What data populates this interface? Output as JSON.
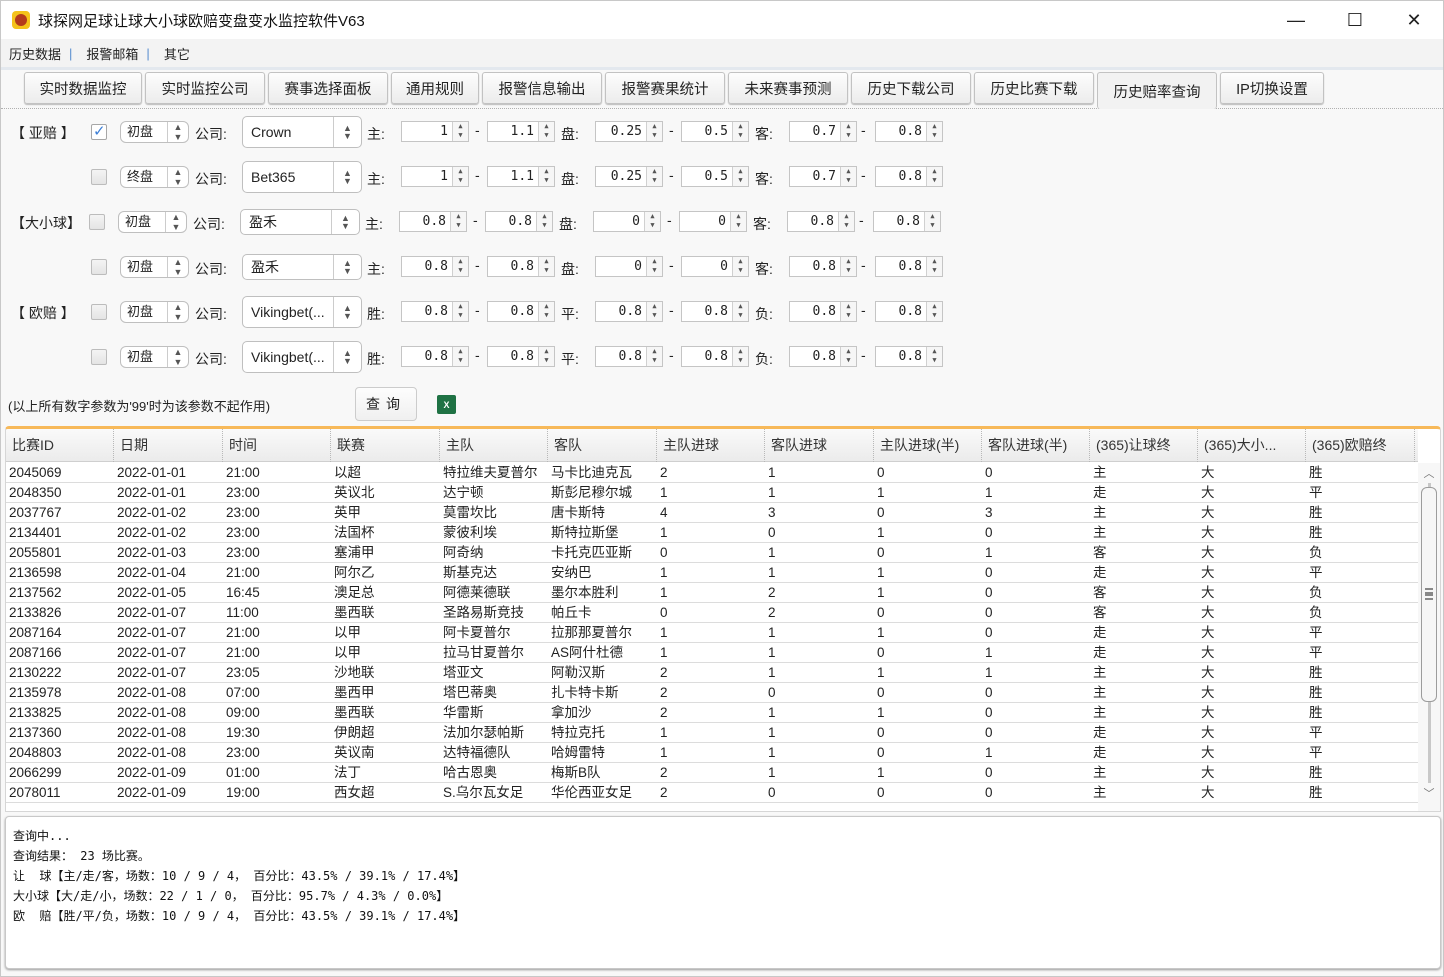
{
  "window": {
    "title": "球探网足球让球大小球欧赔变盘变水监控软件V63",
    "controls": {
      "minimize": "—",
      "maximize": "☐",
      "close": "✕"
    }
  },
  "menu": [
    {
      "label": "历史数据"
    },
    {
      "label": "报警邮箱"
    },
    {
      "label": "其它"
    }
  ],
  "menu_separator": "|",
  "tabs": [
    {
      "label": "实时数据监控",
      "active": false
    },
    {
      "label": "实时监控公司",
      "active": false
    },
    {
      "label": "赛事选择面板",
      "active": false
    },
    {
      "label": "通用规则",
      "active": false
    },
    {
      "label": "报警信息输出",
      "active": false
    },
    {
      "label": "报警赛果统计",
      "active": false
    },
    {
      "label": "未来赛事预测",
      "active": false
    },
    {
      "label": "历史下载公司",
      "active": false
    },
    {
      "label": "历史比赛下载",
      "active": false
    },
    {
      "label": "历史赔率查询",
      "active": true
    },
    {
      "label": "IP切换设置",
      "active": false
    }
  ],
  "form": {
    "company_label": "公司:",
    "rows": [
      {
        "group": "【 亚赔 】",
        "checked": true,
        "stage": "初盘",
        "company": "Crown",
        "l1": "主:",
        "v1": "1",
        "v2": "1.1",
        "l2": "盘:",
        "v3": "0.25",
        "v4": "0.5",
        "l3": "客:",
        "v5": "0.7",
        "v6": "0.8"
      },
      {
        "group": "",
        "checked": false,
        "stage": "终盘",
        "company": "Bet365",
        "l1": "主:",
        "v1": "1",
        "v2": "1.1",
        "l2": "盘:",
        "v3": "0.25",
        "v4": "0.5",
        "l3": "客:",
        "v5": "0.7",
        "v6": "0.8"
      },
      {
        "group": "【大小球】",
        "checked": false,
        "stage": "初盘",
        "company": "盈禾",
        "l1": "主:",
        "v1": "0.8",
        "v2": "0.8",
        "l2": "盘:",
        "v3": "0",
        "v4": "0",
        "l3": "客:",
        "v5": "0.8",
        "v6": "0.8"
      },
      {
        "group": "",
        "checked": false,
        "stage": "初盘",
        "company": "盈禾",
        "l1": "主:",
        "v1": "0.8",
        "v2": "0.8",
        "l2": "盘:",
        "v3": "0",
        "v4": "0",
        "l3": "客:",
        "v5": "0.8",
        "v6": "0.8"
      },
      {
        "group": "【 欧赔 】",
        "checked": false,
        "stage": "初盘",
        "company": "Vikingbet(...",
        "l1": "胜:",
        "v1": "0.8",
        "v2": "0.8",
        "l2": "平:",
        "v3": "0.8",
        "v4": "0.8",
        "l3": "负:",
        "v5": "0.8",
        "v6": "0.8"
      },
      {
        "group": "",
        "checked": false,
        "stage": "初盘",
        "company": "Vikingbet(...",
        "l1": "胜:",
        "v1": "0.8",
        "v2": "0.8",
        "l2": "平:",
        "v3": "0.8",
        "v4": "0.8",
        "l3": "负:",
        "v5": "0.8",
        "v6": "0.8"
      }
    ],
    "range_dash": "-",
    "note": "(以上所有数字参数为'99'时为该参数不起作用)",
    "query_label": "查询",
    "excel_icon": "excel-export-icon"
  },
  "table": {
    "columns": [
      "比赛ID",
      "日期",
      "时间",
      "联赛",
      "主队",
      "客队",
      "主队进球",
      "客队进球",
      "主队进球(半)",
      "客队进球(半)",
      "(365)让球终",
      "(365)大小...",
      "(365)欧赔终"
    ],
    "rows": [
      [
        "2045069",
        "2022-01-01",
        "21:00",
        "以超",
        "特拉维夫夏普尔",
        "马卡比迪克瓦",
        "2",
        "1",
        "0",
        "0",
        "主",
        "大",
        "胜"
      ],
      [
        "2048350",
        "2022-01-01",
        "23:00",
        "英议北",
        "达宁顿",
        "斯彭尼穆尔城",
        "1",
        "1",
        "1",
        "1",
        "走",
        "大",
        "平"
      ],
      [
        "2037767",
        "2022-01-02",
        "23:00",
        "英甲",
        "莫雷坎比",
        "唐卡斯特",
        "4",
        "3",
        "0",
        "3",
        "主",
        "大",
        "胜"
      ],
      [
        "2134401",
        "2022-01-02",
        "23:00",
        "法国杯",
        "蒙彼利埃",
        "斯特拉斯堡",
        "1",
        "0",
        "1",
        "0",
        "主",
        "大",
        "胜"
      ],
      [
        "2055801",
        "2022-01-03",
        "23:00",
        "塞浦甲",
        "阿奇纳",
        "卡托克匹亚斯",
        "0",
        "1",
        "0",
        "1",
        "客",
        "大",
        "负"
      ],
      [
        "2136598",
        "2022-01-04",
        "21:00",
        "阿尔乙",
        "斯基克达",
        "安纳巴",
        "1",
        "1",
        "1",
        "0",
        "走",
        "大",
        "平"
      ],
      [
        "2137562",
        "2022-01-05",
        "16:45",
        "澳足总",
        "阿德莱德联",
        "墨尔本胜利",
        "1",
        "2",
        "1",
        "0",
        "客",
        "大",
        "负"
      ],
      [
        "2133826",
        "2022-01-07",
        "11:00",
        "墨西联",
        "圣路易斯竞技",
        "帕丘卡",
        "0",
        "2",
        "0",
        "0",
        "客",
        "大",
        "负"
      ],
      [
        "2087164",
        "2022-01-07",
        "21:00",
        "以甲",
        "阿卡夏普尔",
        "拉那那夏普尔",
        "1",
        "1",
        "1",
        "0",
        "走",
        "大",
        "平"
      ],
      [
        "2087166",
        "2022-01-07",
        "21:00",
        "以甲",
        "拉马甘夏普尔",
        "AS阿什杜德",
        "1",
        "1",
        "0",
        "1",
        "走",
        "大",
        "平"
      ],
      [
        "2130222",
        "2022-01-07",
        "23:05",
        "沙地联",
        "塔亚文",
        "阿勒汉斯",
        "2",
        "1",
        "1",
        "1",
        "主",
        "大",
        "胜"
      ],
      [
        "2135978",
        "2022-01-08",
        "07:00",
        "墨西甲",
        "塔巴蒂奥",
        "扎卡特卡斯",
        "2",
        "0",
        "0",
        "0",
        "主",
        "大",
        "胜"
      ],
      [
        "2133825",
        "2022-01-08",
        "09:00",
        "墨西联",
        "华雷斯",
        "拿加沙",
        "2",
        "1",
        "1",
        "0",
        "主",
        "大",
        "胜"
      ],
      [
        "2137360",
        "2022-01-08",
        "19:30",
        "伊朗超",
        "法加尔瑟帕斯",
        "特拉克托",
        "1",
        "1",
        "0",
        "0",
        "走",
        "大",
        "平"
      ],
      [
        "2048803",
        "2022-01-08",
        "23:00",
        "英议南",
        "达特福德队",
        "哈姆雷特",
        "1",
        "1",
        "0",
        "1",
        "走",
        "大",
        "平"
      ],
      [
        "2066299",
        "2022-01-09",
        "01:00",
        "法丁",
        "哈古恩奥",
        "梅斯B队",
        "2",
        "1",
        "1",
        "0",
        "主",
        "大",
        "胜"
      ],
      [
        "2078011",
        "2022-01-09",
        "19:00",
        "西女超",
        "S.乌尔瓦女足",
        "华伦西亚女足",
        "2",
        "0",
        "0",
        "0",
        "主",
        "大",
        "胜"
      ]
    ]
  },
  "log": [
    "查询中...",
    "查询结果： 23 场比赛。",
    "让  球【主/走/客，场数：10 / 9 / 4， 百分比：43.5% / 39.1% / 17.4%】",
    "大小球【大/走/小，场数：22 / 1 / 0， 百分比：95.7% / 4.3% / 0.0%】",
    "欧  赔【胜/平/负，场数：10 / 9 / 4， 百分比：43.5% / 39.1% / 17.4%】"
  ]
}
